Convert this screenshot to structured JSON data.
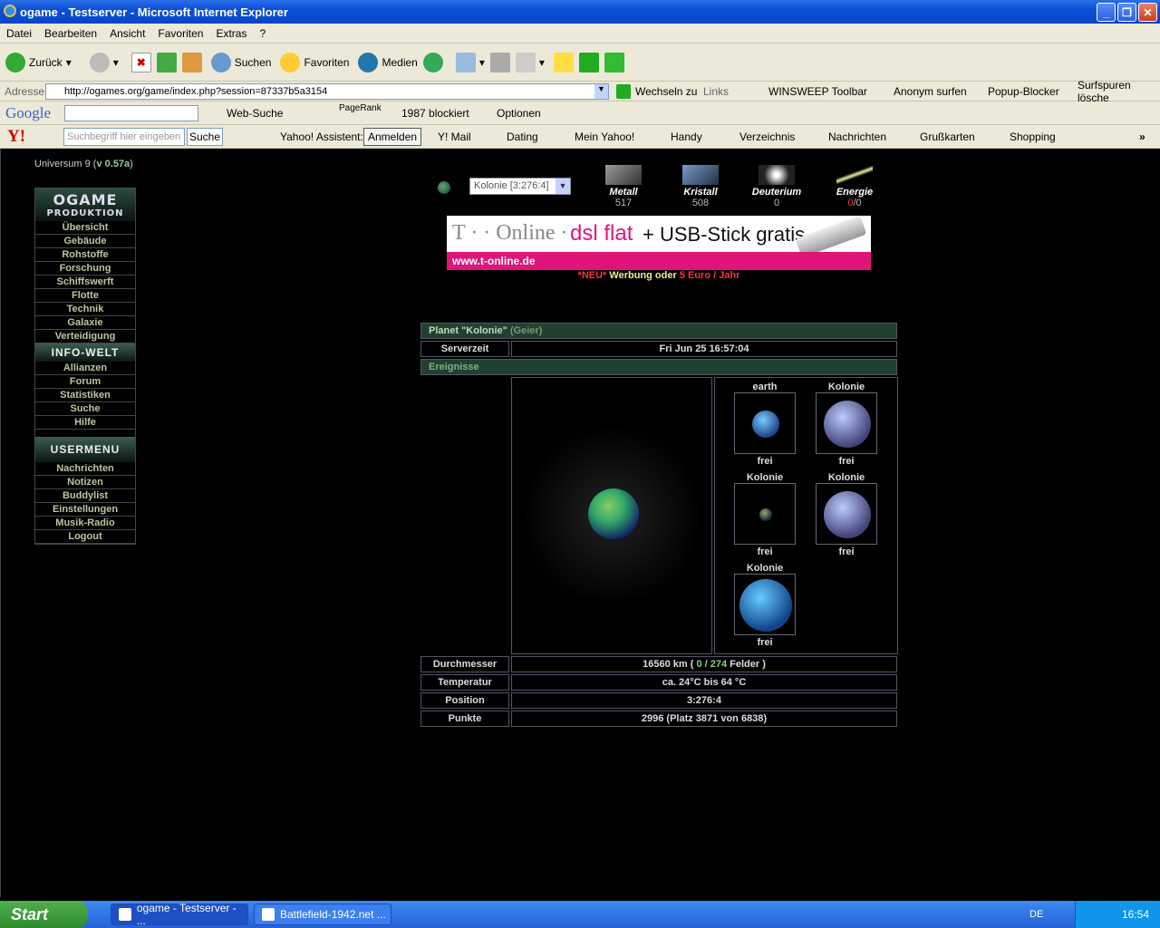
{
  "window": {
    "title": "ogame - Testserver - Microsoft Internet Explorer"
  },
  "menubar": [
    "Datei",
    "Bearbeiten",
    "Ansicht",
    "Favoriten",
    "Extras",
    "?"
  ],
  "toolbar": {
    "back": "Zurück",
    "search": "Suchen",
    "favorites": "Favoriten",
    "media": "Medien"
  },
  "address": {
    "label": "Adresse",
    "url": "http://ogames.org/game/index.php?session=87337b5a3154",
    "go": "Wechseln zu",
    "links": "Links",
    "winsweep": "WINSWEEP Toolbar",
    "anon": "Anonym surfen",
    "popup": "Popup-Blocker",
    "surf": "Surfspuren lösche"
  },
  "google": {
    "logo": "Google",
    "websuche": "Web-Suche",
    "pagerank": "PageRank",
    "blocked": "1987 blockiert",
    "options": "Optionen"
  },
  "yahoo": {
    "logo": "Y!",
    "placeholder": "Suchbegriff hier eingeben",
    "search": "Suche",
    "assistant": "Yahoo! Assistent:",
    "login": "Anmelden",
    "mail": "Y! Mail",
    "dating": "Dating",
    "myyahoo": "Mein Yahoo!",
    "handy": "Handy",
    "dir": "Verzeichnis",
    "news": "Nachrichten",
    "cards": "Grußkarten",
    "shopping": "Shopping"
  },
  "game": {
    "universe_prefix": "Universum 9 (",
    "version": "v 0.57a",
    "universe_suffix": ")",
    "logo_top": "OGAME",
    "logo_bottom": "PRODUKTION",
    "menu1": [
      "Übersicht",
      "Gebäude",
      "Rohstoffe",
      "Forschung",
      "Schiffswerft",
      "Flotte",
      "Technik",
      "Galaxie",
      "Verteidigung"
    ],
    "infohdr": "INFO-WELT",
    "menu2": [
      "Allianzen",
      "Forum",
      "Statistiken",
      "Suche",
      "Hilfe"
    ],
    "userhdr": "USERMENU",
    "menu3": [
      "Nachrichten",
      "Notizen",
      "Buddylist",
      "Einstellungen",
      "Musik-Radio",
      "Logout"
    ],
    "planet_select": "Kolonie [3:276:4]",
    "resources": [
      {
        "name": "Metall",
        "value": "517"
      },
      {
        "name": "Kristall",
        "value": "508"
      },
      {
        "name": "Deuterium",
        "value": "0"
      },
      {
        "name": "Energie",
        "value_red": "0",
        "value_rest": "/0"
      }
    ],
    "banner": {
      "brand": "T · · Online ·",
      "text": "dsl flat",
      "text2": "+ USB-Stick gratis",
      "url": "www.t-online.de"
    },
    "ad": {
      "neu": "*NEU*",
      "mid": " Werbung oder ",
      "price": "5 Euro / Jahr"
    },
    "planet_title": "Planet \"Kolonie\"",
    "owner": "(Geier)",
    "server_label": "Serverzeit",
    "server_time": "Fri Jun 25 16:57:04",
    "events": "Ereignisse",
    "planets": [
      {
        "name": "earth",
        "status": "frei"
      },
      {
        "name": "Kolonie",
        "status": "frei"
      },
      {
        "name": "Kolonie",
        "status": "frei"
      },
      {
        "name": "Kolonie",
        "status": "frei"
      },
      {
        "name": "Kolonie",
        "status": "frei"
      }
    ],
    "rows": [
      {
        "label": "Durchmesser",
        "pre": "16560 km ( ",
        "f1": "0",
        "sep": " / ",
        "f2": "274",
        "post": " Felder )"
      },
      {
        "label": "Temperatur",
        "value": "ca. 24°C bis 64 °C"
      },
      {
        "label": "Position",
        "value": "3:276:4"
      },
      {
        "label": "Punkte",
        "value": "2996 (Platz 3871 von 6838)"
      }
    ]
  },
  "taskbar": {
    "start": "Start",
    "task1": "ogame - Testserver - ...",
    "task2": "Battlefield-1942.net ...",
    "lang": "DE",
    "clock": "16:54"
  }
}
